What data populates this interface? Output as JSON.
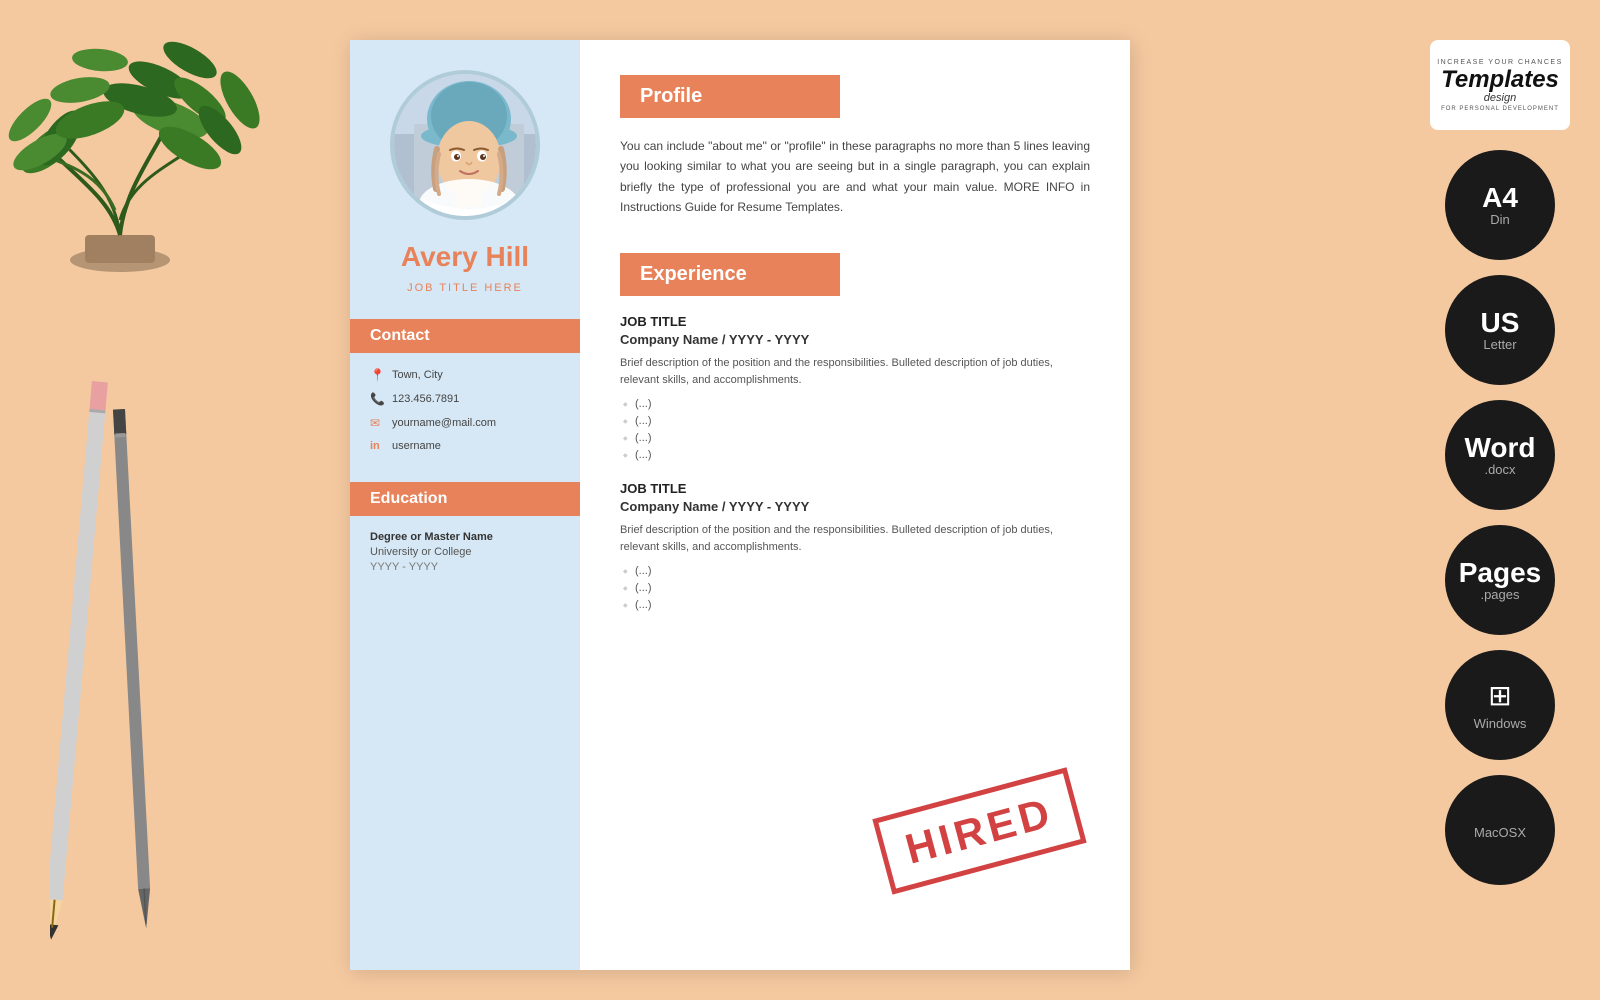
{
  "background_color": "#f5c9a0",
  "resume": {
    "name": "Avery Hill",
    "job_title": "JOB TITLE HERE",
    "contact": {
      "label": "Contact",
      "location": "Town, City",
      "phone": "123.456.7891",
      "email": "yourname@mail.com",
      "linkedin": "username"
    },
    "education": {
      "label": "Education",
      "degree": "Degree or Master Name",
      "school": "University or College",
      "year": "YYYY - YYYY"
    },
    "profile": {
      "label": "Profile",
      "text": "You can include \"about me\" or \"profile\" in these paragraphs no more than 5 lines leaving you looking similar to what you are seeing but in a single paragraph, you can explain briefly the type of professional you are and what your main value. MORE INFO in Instructions Guide for Resume Templates."
    },
    "experience": {
      "label": "Experience",
      "jobs": [
        {
          "title": "JOB TITLE",
          "company_year": "Company Name / YYYY - YYYY",
          "description": "Brief description of the position and the responsibilities. Bulleted description of job duties, relevant skills, and accomplishments.",
          "bullets": [
            "(...)",
            "(...)",
            "(...)",
            "(...)"
          ]
        },
        {
          "title": "JOB TITLE",
          "company_year": "Company Name / YYYY - YYYY",
          "description": "Brief description of the position and the responsibilities. Bulleted description of job duties, relevant skills, and accomplishments.",
          "bullets": [
            "(...)",
            "(...)",
            "(...)"
          ]
        }
      ]
    }
  },
  "stamp": {
    "text": "HIRED"
  },
  "brand": {
    "increase_text": "INCREASE YOUR CHANCES",
    "name": "Templates",
    "sub": "design",
    "personal_dev": "FOR PERSONAL DEVELOPMENT"
  },
  "formats": [
    {
      "main": "A4",
      "sub": "Din"
    },
    {
      "main": "US",
      "sub": "Letter"
    },
    {
      "main": "Word",
      "sub": ".docx"
    },
    {
      "main": "Pages",
      "sub": ".pages"
    },
    {
      "main": "Windows",
      "sub": "",
      "icon": "⊞"
    },
    {
      "main": "",
      "sub": "MacOSX",
      "icon": ""
    }
  ]
}
